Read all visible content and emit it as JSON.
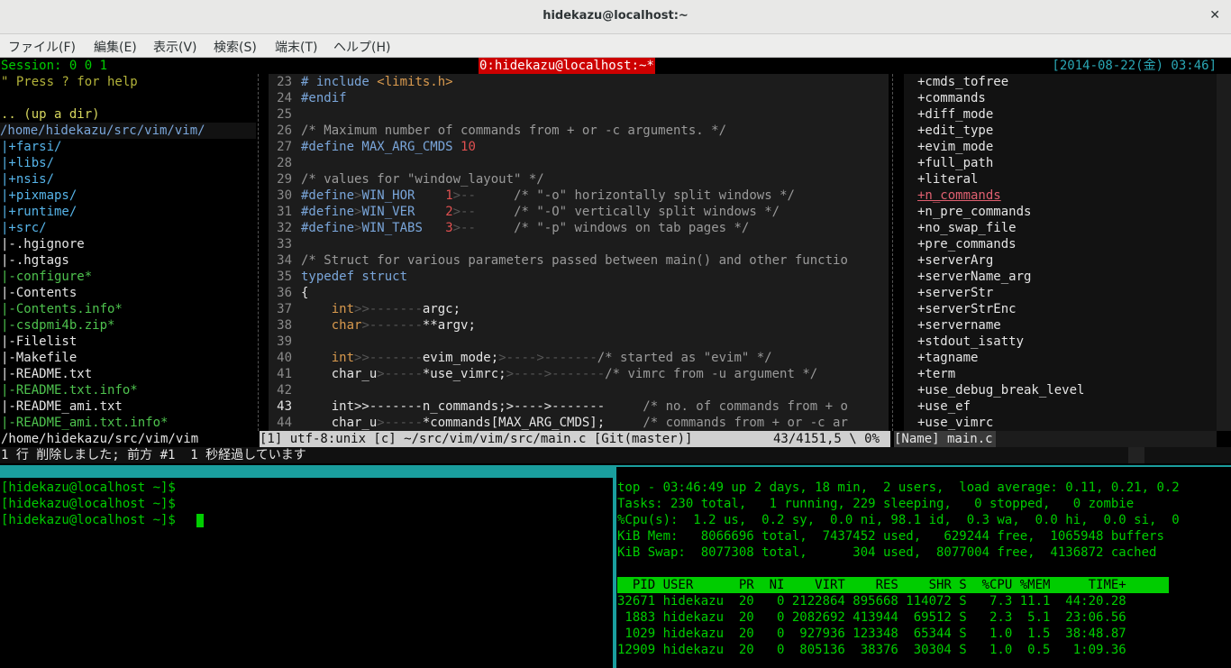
{
  "window": {
    "title": "hidekazu@localhost:~",
    "close_icon": "✕"
  },
  "menu": [
    "ファイル(F)",
    "編集(E)",
    "表示(V)",
    "検索(S)",
    "端末(T)",
    "ヘルプ(H)"
  ],
  "tmux": {
    "session": "Session: 0 0 1",
    "window_name": "0:hidekazu@localhost:~*",
    "datetime": "[2014-08-22(金) 03:46]"
  },
  "explorer": {
    "help": "\" Press ? for help",
    "up": ".. (up a dir)",
    "path": "/home/hidekazu/src/vim/vim/",
    "items": [
      {
        "text": "|+farsi/",
        "color": "#56b4e9"
      },
      {
        "text": "|+libs/",
        "color": "#56b4e9"
      },
      {
        "text": "|+nsis/",
        "color": "#56b4e9"
      },
      {
        "text": "|+pixmaps/",
        "color": "#56b4e9"
      },
      {
        "text": "|+runtime/",
        "color": "#56b4e9"
      },
      {
        "text": "|+src/",
        "color": "#56b4e9"
      },
      {
        "text": "|-.hgignore",
        "color": "#e5e5e5"
      },
      {
        "text": "|-.hgtags",
        "color": "#e5e5e5"
      },
      {
        "text": "|-configure*",
        "color": "#4ec24e"
      },
      {
        "text": "|-Contents",
        "color": "#e5e5e5"
      },
      {
        "text": "|-Contents.info*",
        "color": "#4ec24e"
      },
      {
        "text": "|-csdpmi4b.zip*",
        "color": "#4ec24e"
      },
      {
        "text": "|-Filelist",
        "color": "#e5e5e5"
      },
      {
        "text": "|-Makefile",
        "color": "#e5e5e5"
      },
      {
        "text": "|-README.txt",
        "color": "#e5e5e5"
      },
      {
        "text": "|-README.txt.info*",
        "color": "#4ec24e"
      },
      {
        "text": "|-README_ami.txt",
        "color": "#e5e5e5"
      },
      {
        "text": "|-README_ami.txt.info*",
        "color": "#4ec24e"
      }
    ],
    "status": "/home/hidekazu/src/vim/vim"
  },
  "editor": {
    "lines": [
      {
        "n": "23",
        "segs": [
          {
            "t": "# include ",
            "c": "bl"
          },
          {
            "t": "<limits.h>",
            "c": "or"
          }
        ]
      },
      {
        "n": "24",
        "segs": [
          {
            "t": "#endif",
            "c": "bl"
          }
        ]
      },
      {
        "n": "25",
        "segs": []
      },
      {
        "n": "26",
        "segs": [
          {
            "t": "/* Maximum number of commands from + or -c arguments. */",
            "c": "cm"
          }
        ]
      },
      {
        "n": "27",
        "segs": [
          {
            "t": "#define MAX_ARG_CMDS ",
            "c": "bl"
          },
          {
            "t": "10",
            "c": "rd"
          }
        ]
      },
      {
        "n": "28",
        "segs": []
      },
      {
        "n": "29",
        "segs": [
          {
            "t": "/* values for \"window_layout\" */",
            "c": "cm"
          }
        ]
      },
      {
        "n": "30",
        "segs": [
          {
            "t": "#define",
            "c": "bl"
          },
          {
            "t": ">",
            "c": "tab"
          },
          {
            "t": "WIN_HOR",
            "c": "bl"
          },
          {
            "t": "    ",
            "c": "tab"
          },
          {
            "t": "1",
            "c": "rd"
          },
          {
            "t": ">--     ",
            "c": "tab"
          },
          {
            "t": "/* \"-o\" horizontally split windows */",
            "c": "cm"
          }
        ]
      },
      {
        "n": "31",
        "segs": [
          {
            "t": "#define",
            "c": "bl"
          },
          {
            "t": ">",
            "c": "tab"
          },
          {
            "t": "WIN_VER",
            "c": "bl"
          },
          {
            "t": "    ",
            "c": "tab"
          },
          {
            "t": "2",
            "c": "rd"
          },
          {
            "t": ">--     ",
            "c": "tab"
          },
          {
            "t": "/* \"-O\" vertically split windows */",
            "c": "cm"
          }
        ]
      },
      {
        "n": "32",
        "segs": [
          {
            "t": "#define",
            "c": "bl"
          },
          {
            "t": ">",
            "c": "tab"
          },
          {
            "t": "WIN_TABS",
            "c": "bl"
          },
          {
            "t": "   ",
            "c": "tab"
          },
          {
            "t": "3",
            "c": "rd"
          },
          {
            "t": ">--     ",
            "c": "tab"
          },
          {
            "t": "/* \"-p\" windows on tab pages */",
            "c": "cm"
          }
        ]
      },
      {
        "n": "33",
        "segs": []
      },
      {
        "n": "34",
        "segs": [
          {
            "t": "/* Struct for various parameters passed between main() and other functio",
            "c": "cm"
          }
        ]
      },
      {
        "n": "35",
        "segs": [
          {
            "t": "typedef struct",
            "c": "bl"
          }
        ]
      },
      {
        "n": "36",
        "segs": [
          {
            "t": "{",
            "c": "w"
          }
        ]
      },
      {
        "n": "37",
        "segs": [
          {
            "t": "    ",
            "c": "w"
          },
          {
            "t": "int",
            "c": "or"
          },
          {
            "t": ">>-------",
            "c": "tab"
          },
          {
            "t": "argc;",
            "c": "w"
          }
        ]
      },
      {
        "n": "38",
        "segs": [
          {
            "t": "    ",
            "c": "w"
          },
          {
            "t": "char",
            "c": "or"
          },
          {
            "t": ">-------",
            "c": "tab"
          },
          {
            "t": "**argv;",
            "c": "w"
          }
        ]
      },
      {
        "n": "39",
        "segs": []
      },
      {
        "n": "40",
        "segs": [
          {
            "t": "    ",
            "c": "w"
          },
          {
            "t": "int",
            "c": "or"
          },
          {
            "t": ">>-------",
            "c": "tab"
          },
          {
            "t": "evim_mode;",
            "c": "w"
          },
          {
            "t": ">---->-------",
            "c": "tab"
          },
          {
            "t": "/* started as \"evim\" */",
            "c": "cm"
          }
        ]
      },
      {
        "n": "41",
        "segs": [
          {
            "t": "    char_u",
            "c": "w"
          },
          {
            "t": ">-----",
            "c": "tab"
          },
          {
            "t": "*use_vimrc;",
            "c": "w"
          },
          {
            "t": ">---->-------",
            "c": "tab"
          },
          {
            "t": "/* vimrc from -u argument */",
            "c": "cm"
          }
        ]
      },
      {
        "n": "42",
        "segs": []
      },
      {
        "n": "43",
        "segs": [
          {
            "t": "    int>>-------n_commands;>---->-------     ",
            "c": "w"
          },
          {
            "t": "/* no. of commands from + o",
            "c": "cm"
          }
        ]
      },
      {
        "n": "44",
        "segs": [
          {
            "t": "    char_u",
            "c": "w"
          },
          {
            "t": ">-----",
            "c": "tab"
          },
          {
            "t": "*commands[MAX_ARG_CMDS];     ",
            "c": "w"
          },
          {
            "t": "/* commands from + or -c ar",
            "c": "cm"
          }
        ]
      }
    ],
    "status_left": "[1] utf-8:unix [c] ~/src/vim/vim/src/main.c [Git(master)]",
    "status_right": "43/4151,5 \\ 0%"
  },
  "taglist": {
    "items": [
      "+cmds_tofree",
      "+commands",
      "+diff_mode",
      "+edit_type",
      "+evim_mode",
      "+full_path",
      "+literal",
      "+n_commands",
      "+n_pre_commands",
      "+no_swap_file",
      "+pre_commands",
      "+serverArg",
      "+serverName_arg",
      "+serverStr",
      "+serverStrEnc",
      "+servername",
      "+stdout_isatty",
      "+tagname",
      "+term",
      "+use_debug_break_level",
      "+use_ef",
      "+use_vimrc"
    ],
    "selected_index": 7,
    "status": "[Name] main.c"
  },
  "vim_message": "1 行 削除しました; 前方 #1  1 秒経過しています",
  "shell": {
    "lines": [
      "[hidekazu@localhost ~]$",
      "[hidekazu@localhost ~]$",
      "[hidekazu@localhost ~]$ "
    ]
  },
  "top": {
    "summary": [
      "top - 03:46:49 up 2 days, 18 min,  2 users,  load average: 0.11, 0.21, 0.2",
      "Tasks: 230 total,   1 running, 229 sleeping,   0 stopped,   0 zombie",
      "%Cpu(s):  1.2 us,  0.2 sy,  0.0 ni, 98.1 id,  0.3 wa,  0.0 hi,  0.0 si,  0",
      "KiB Mem:   8066696 total,  7437452 used,   629244 free,  1065948 buffers",
      "KiB Swap:  8077308 total,      304 used,  8077004 free,  4136872 cached"
    ],
    "header": "  PID USER      PR  NI    VIRT    RES    SHR S  %CPU %MEM     TIME+ ",
    "rows": [
      "32671 hidekazu  20   0 2122864 895668 114072 S   7.3 11.1  44:20.28",
      " 1883 hidekazu  20   0 2082692 413944  69512 S   2.3  5.1  23:06.56",
      " 1029 hidekazu  20   0  927936 123348  65344 S   1.0  1.5  38:48.87",
      "12909 hidekazu  20   0  805136  38376  30304 S   1.0  0.5   1:09.36"
    ]
  },
  "colors": {
    "term_green": "#00cd00",
    "tmux_red": "#cd0000",
    "pane_border": "#1a9e9e",
    "status_bar": "#d0d0d0"
  }
}
